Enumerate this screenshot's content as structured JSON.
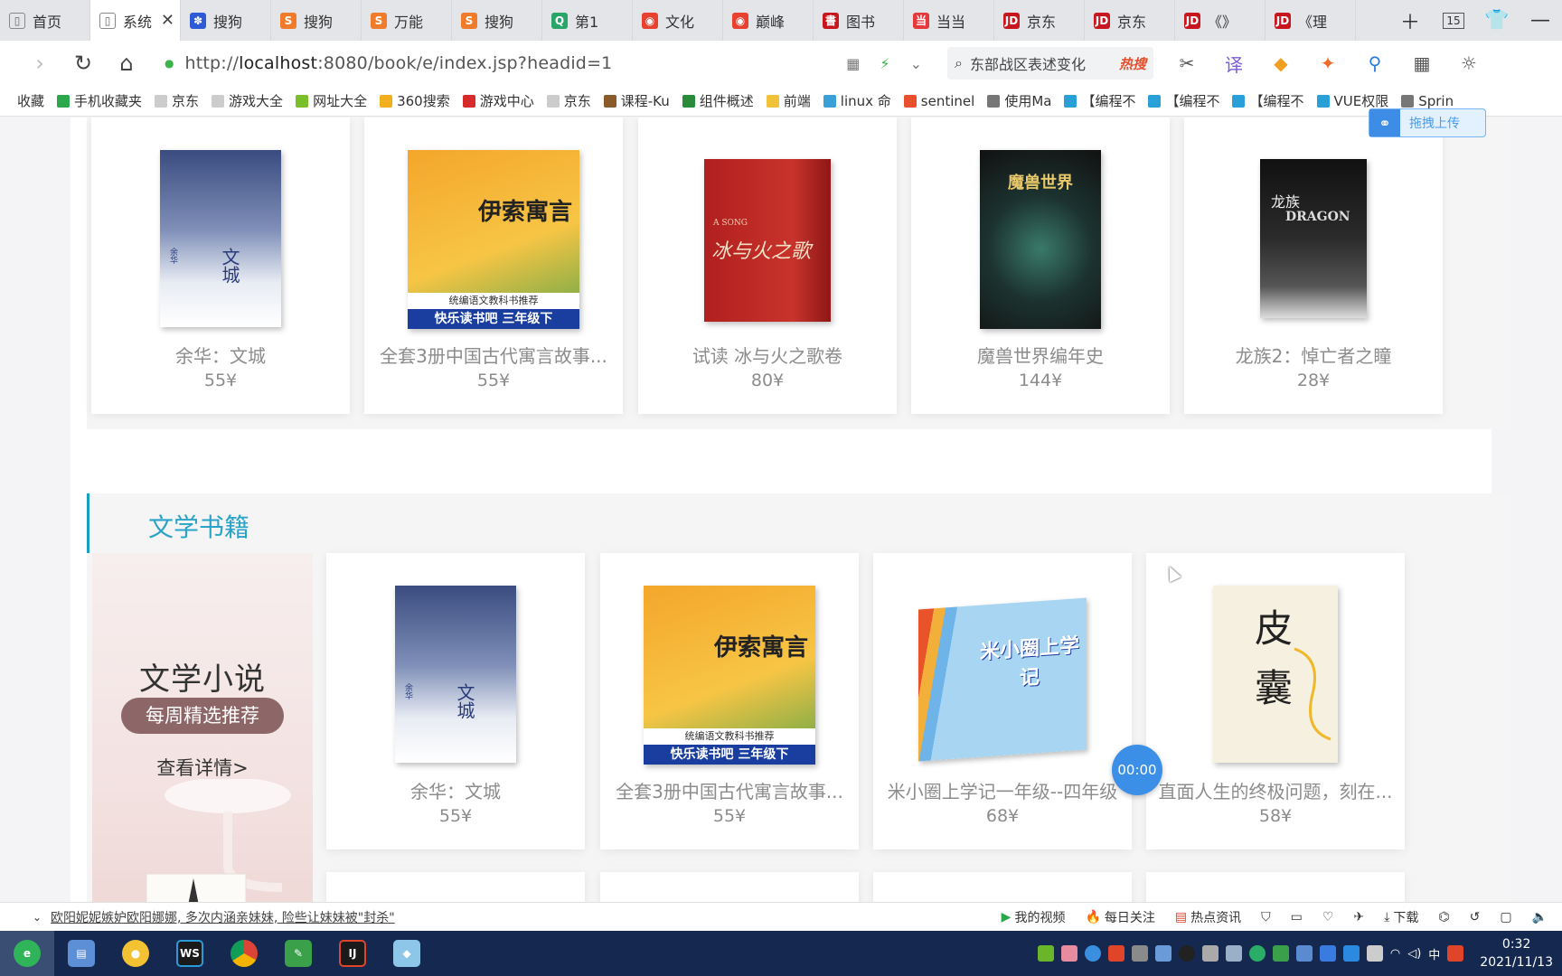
{
  "browser": {
    "tabs": [
      {
        "label": "首页",
        "icon_color": "#ffffff",
        "icon_glyph": "▯"
      },
      {
        "label": "系统",
        "icon_color": "#ffffff",
        "icon_glyph": "▯",
        "active": true
      },
      {
        "label": "搜狗",
        "icon_color": "#2d5bd8",
        "icon_glyph": "✽"
      },
      {
        "label": "搜狗",
        "icon_color": "#f07b2b",
        "icon_glyph": "S"
      },
      {
        "label": "万能",
        "icon_color": "#f07b2b",
        "icon_glyph": "S"
      },
      {
        "label": "搜狗",
        "icon_color": "#f07b2b",
        "icon_glyph": "S"
      },
      {
        "label": "第1",
        "icon_color": "#2aa56a",
        "icon_glyph": "Q"
      },
      {
        "label": "文化",
        "icon_color": "#e8412f",
        "icon_glyph": "◉"
      },
      {
        "label": "巅峰",
        "icon_color": "#e8412f",
        "icon_glyph": "◉"
      },
      {
        "label": "图书",
        "icon_color": "#c8161e",
        "icon_glyph": "書"
      },
      {
        "label": "当当",
        "icon_color": "#e7393c",
        "icon_glyph": "当"
      },
      {
        "label": "京东",
        "icon_color": "#c8161e",
        "icon_glyph": "JD"
      },
      {
        "label": "京东",
        "icon_color": "#c8161e",
        "icon_glyph": "JD"
      },
      {
        "label": "《》",
        "icon_color": "#c8161e",
        "icon_glyph": "JD"
      },
      {
        "label": "《理",
        "icon_color": "#c8161e",
        "icon_glyph": "JD"
      }
    ],
    "tab_count": "15",
    "url_prefix": "http://",
    "url_host": "localhost",
    "url_rest": ":8080/book/e/index.jsp?headid=1",
    "search_hint": "东部战区表述变化",
    "hot_label": "热搜",
    "bookmarks": [
      {
        "label": "收藏",
        "color": "transparent"
      },
      {
        "label": "手机收藏夹",
        "color": "#2aa84a"
      },
      {
        "label": "京东",
        "color": "#cccccc"
      },
      {
        "label": "游戏大全",
        "color": "#cccccc"
      },
      {
        "label": "网址大全",
        "color": "#7bbf2a"
      },
      {
        "label": "360搜索",
        "color": "#f2b01e"
      },
      {
        "label": "游戏中心",
        "color": "#d62b2b"
      },
      {
        "label": "京东",
        "color": "#cccccc"
      },
      {
        "label": "课程-Ku",
        "color": "#8a5a2b"
      },
      {
        "label": "组件概述",
        "color": "#2a8a3a"
      },
      {
        "label": "前端",
        "color": "#f0c23a"
      },
      {
        "label": "linux 命",
        "color": "#3aa0d8"
      },
      {
        "label": "sentinel",
        "color": "#e8502b"
      },
      {
        "label": "使用Ma",
        "color": "#777777"
      },
      {
        "label": "【编程不",
        "color": "#2aa0d8"
      },
      {
        "label": "【编程不",
        "color": "#2aa0d8"
      },
      {
        "label": "【编程不",
        "color": "#2aa0d8"
      },
      {
        "label": "VUE权限",
        "color": "#2aa0d8"
      },
      {
        "label": "Sprin",
        "color": "#777777"
      }
    ]
  },
  "top_row": [
    {
      "name": "余华：文城",
      "price": "55¥",
      "cover": "wencheng"
    },
    {
      "name": "全套3册中国古代寓言故事...",
      "price": "55¥",
      "cover": "yisuo"
    },
    {
      "name": "试读 冰与火之歌卷",
      "price": "80¥",
      "cover": "bingyuhuo"
    },
    {
      "name": "魔兽世界编年史",
      "price": "144¥",
      "cover": "moshou"
    },
    {
      "name": "龙族2：悼亡者之瞳",
      "price": "28¥",
      "cover": "longzu"
    }
  ],
  "literature": {
    "section_title": "文学书籍",
    "promo": {
      "title": "文学小说",
      "pill": "每周精选推荐",
      "more": "查看详情>"
    },
    "books": [
      {
        "name": "余华：文城",
        "price": "55¥",
        "cover": "wencheng"
      },
      {
        "name": "全套3册中国古代寓言故事...",
        "price": "55¥",
        "cover": "yisuo"
      },
      {
        "name": "米小圈上学记一年级--四年级",
        "price": "68¥",
        "cover": "mixiaoquan"
      },
      {
        "name": "直面人生的终极问题，刻在...",
        "price": "58¥",
        "cover": "pinang"
      }
    ]
  },
  "covers": {
    "wencheng": {
      "title": "文城",
      "sub": "余华"
    },
    "yisuo": {
      "title": "伊索寓言",
      "band": "快乐读书吧 三年级下",
      "badge": "统编语文教科书推荐"
    },
    "bingyuhuo": {
      "title": "冰与火之歌",
      "sub": "A SONG"
    },
    "moshou": {
      "title": "魔兽世界"
    },
    "longzu": {
      "title": "龙族",
      "sub": "DRAGON"
    },
    "mixiaoquan": {
      "title": "米小圈上学记"
    },
    "pinang": {
      "title": "皮囊"
    }
  },
  "upload_label": "拖拽上传",
  "timer_label": "00:00",
  "status": {
    "news": "欧阳妮妮嫉妒欧阳娜娜, 多次内涵亲妹妹, 险些让妹妹被\"封杀\"",
    "items": [
      "我的视频",
      "每日关注",
      "热点资讯",
      "下载"
    ]
  },
  "taskbar": {
    "time": "0:32",
    "date": "2021/11/13",
    "ime": "中"
  }
}
